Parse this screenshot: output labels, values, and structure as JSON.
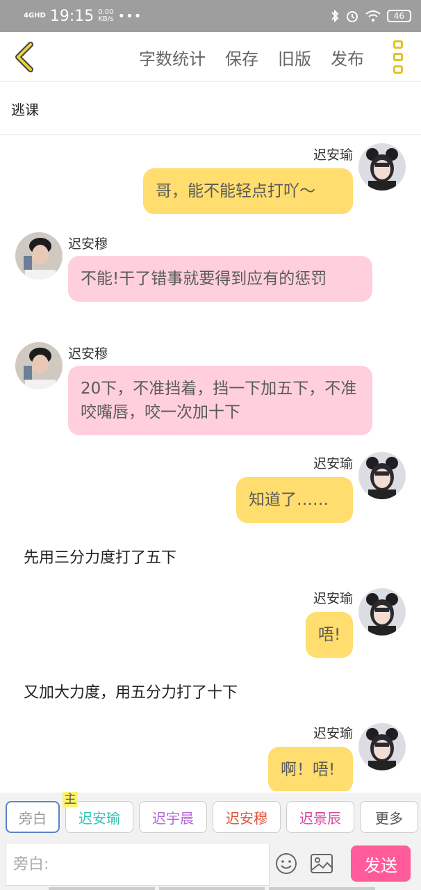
{
  "status_bar": {
    "signal": "4GHD",
    "time": "19:15",
    "speed_value": "0.00",
    "speed_unit": "KB/s",
    "more": "•••",
    "battery": "46"
  },
  "toolbar": {
    "word_count": "字数统计",
    "save": "保存",
    "old_version": "旧版",
    "publish": "发布"
  },
  "story_title": "逃课",
  "messages": [
    {
      "speaker": "迟安瑜",
      "text": "哥，能不能轻点打吖～"
    },
    {
      "speaker": "迟安穆",
      "text": "不能!干了错事就要得到应有的惩罚"
    },
    {
      "speaker": "迟安穆",
      "text": "20下，不准挡着，挡一下加五下，不准咬嘴唇，咬一次加十下"
    },
    {
      "speaker": "迟安瑜",
      "text": "知道了……"
    },
    {
      "narration": "先用三分力度打了五下"
    },
    {
      "speaker": "迟安瑜",
      "text": "唔!"
    },
    {
      "narration": "又加大力度，用五分力打了十下"
    },
    {
      "speaker": "迟安瑜",
      "text": "啊！唔!"
    }
  ],
  "characters": [
    {
      "label": "旁白",
      "color": "#999999"
    },
    {
      "label": "迟安瑜",
      "color": "#2ec4b6",
      "badge": "主"
    },
    {
      "label": "迟宇晨",
      "color": "#b46ad6"
    },
    {
      "label": "迟安穆",
      "color": "#e0533a"
    },
    {
      "label": "迟景辰",
      "color": "#d94aa0"
    },
    {
      "label": "更多",
      "color": "#555555"
    }
  ],
  "input": {
    "placeholder": "旁白:"
  },
  "send_label": "发送",
  "colors": {
    "right_bubble": "#ffdd6e",
    "left_bubble": "#ffd0dc",
    "send": "#ff5b9a",
    "accent": "#e3c229"
  },
  "icons": [
    "back-chevron-icon",
    "menu-dots-icon",
    "bluetooth-icon",
    "alarm-icon",
    "wifi-icon",
    "battery-icon",
    "emoji-icon",
    "image-icon"
  ]
}
